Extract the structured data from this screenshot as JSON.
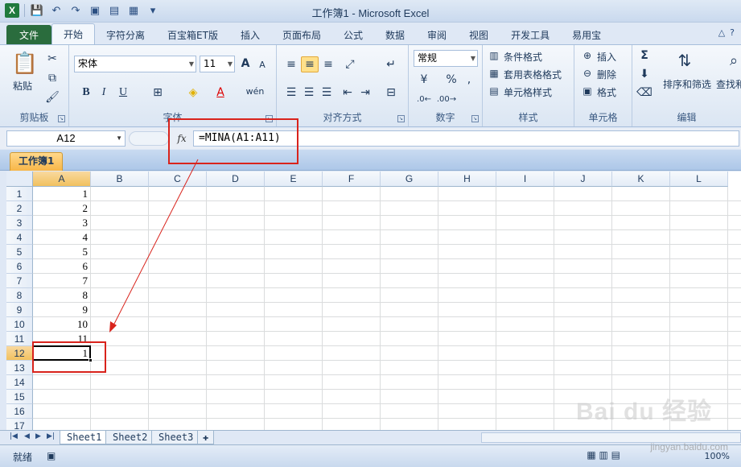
{
  "window": {
    "title": "工作簿1 - Microsoft Excel",
    "qat": {
      "logo": "X",
      "save": "💾",
      "undo": "↶",
      "redo": "↷",
      "more": "▾"
    }
  },
  "tabs": [
    "文件",
    "开始",
    "字符分离",
    "百宝箱ET版",
    "插入",
    "页面布局",
    "公式",
    "数据",
    "审阅",
    "视图",
    "开发工具",
    "易用宝"
  ],
  "ribbon": {
    "clipboard": {
      "paste": "粘贴",
      "label": "剪贴板"
    },
    "font": {
      "name": "宋体",
      "size": "11",
      "bold": "B",
      "italic": "I",
      "underline": "U",
      "wen": "wén",
      "label": "字体"
    },
    "alignment": {
      "label": "对齐方式"
    },
    "number": {
      "format": "常规",
      "percent": "%",
      "comma": ",",
      "label": "数字"
    },
    "styles": {
      "conditional": "条件格式",
      "table": "套用表格格式",
      "cell": "单元格样式",
      "label": "样式"
    },
    "cells": {
      "insert": "插入",
      "delete": "删除",
      "format": "格式",
      "label": "单元格"
    },
    "editing": {
      "sum": "Σ",
      "sort": "排序和筛选",
      "find": "查找和",
      "label": "编辑"
    }
  },
  "formula_bar": {
    "name_box": "A12",
    "fx": "fx",
    "formula": "=MINA(A1:A11)"
  },
  "workbook_tab": "工作簿1",
  "columns": [
    "A",
    "B",
    "C",
    "D",
    "E",
    "F",
    "G",
    "H",
    "I",
    "J",
    "K",
    "L"
  ],
  "rows": [
    "1",
    "2",
    "3",
    "4",
    "5",
    "6",
    "7",
    "8",
    "9",
    "10",
    "11",
    "12",
    "13",
    "14",
    "15",
    "16",
    "17"
  ],
  "cells_a": [
    "1",
    "2",
    "3",
    "4",
    "5",
    "6",
    "7",
    "8",
    "9",
    "10",
    "11",
    "1"
  ],
  "selected": {
    "column": "A",
    "row": "12"
  },
  "sheets": [
    "Sheet1",
    "Sheet2",
    "Sheet3"
  ],
  "status": {
    "ready": "就绪",
    "zoom": "100%"
  },
  "watermark": {
    "brand": "Bai du 经验",
    "sub": "jingyan.baidu.com"
  },
  "colors": {
    "annotation": "#d9231c",
    "file_tab": "#2a6c3d",
    "selected_header": "#f1c15f"
  }
}
